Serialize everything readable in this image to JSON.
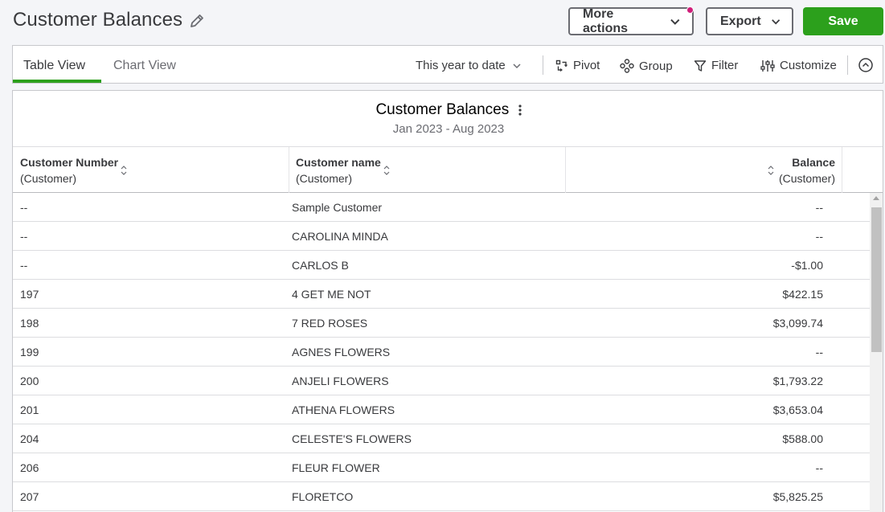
{
  "header": {
    "title": "Customer Balances",
    "more_actions_label": "More actions",
    "export_label": "Export",
    "save_label": "Save"
  },
  "toolbar": {
    "tabs": [
      {
        "label": "Table View",
        "active": true
      },
      {
        "label": "Chart View",
        "active": false
      }
    ],
    "date_range": "This year to date",
    "pivot_label": "Pivot",
    "group_label": "Group",
    "filter_label": "Filter",
    "customize_label": "Customize"
  },
  "report": {
    "title": "Customer Balances",
    "subtitle": "Jan 2023 - Aug 2023",
    "columns": [
      {
        "label": "Customer Number",
        "sub": "(Customer)"
      },
      {
        "label": "Customer name",
        "sub": "(Customer)"
      },
      {
        "label": "Balance",
        "sub": "(Customer)"
      }
    ],
    "rows": [
      {
        "number": "--",
        "name": "Sample Customer",
        "balance": "--"
      },
      {
        "number": "--",
        "name": "CAROLINA MINDA",
        "balance": "--"
      },
      {
        "number": "--",
        "name": "CARLOS B",
        "balance": "-$1.00"
      },
      {
        "number": "197",
        "name": "4 GET ME NOT",
        "balance": "$422.15"
      },
      {
        "number": "198",
        "name": "7 RED ROSES",
        "balance": "$3,099.74"
      },
      {
        "number": "199",
        "name": "AGNES FLOWERS",
        "balance": "--"
      },
      {
        "number": "200",
        "name": "ANJELI FLOWERS",
        "balance": "$1,793.22"
      },
      {
        "number": "201",
        "name": "ATHENA FLOWERS",
        "balance": "$3,653.04"
      },
      {
        "number": "204",
        "name": "CELESTE'S FLOWERS",
        "balance": "$588.00"
      },
      {
        "number": "206",
        "name": "FLEUR FLOWER",
        "balance": "--"
      },
      {
        "number": "207",
        "name": "FLORETCO",
        "balance": "$5,825.25"
      }
    ]
  },
  "colors": {
    "accent_green": "#2ca01c",
    "notification_dot": "#d01f7a",
    "text": "#393a3d"
  },
  "icons": [
    "pencil-icon",
    "chevron-down-icon",
    "pivot-icon",
    "group-icon",
    "filter-icon",
    "customize-icon",
    "collapse-icon",
    "kebab-icon",
    "sort-icon"
  ]
}
